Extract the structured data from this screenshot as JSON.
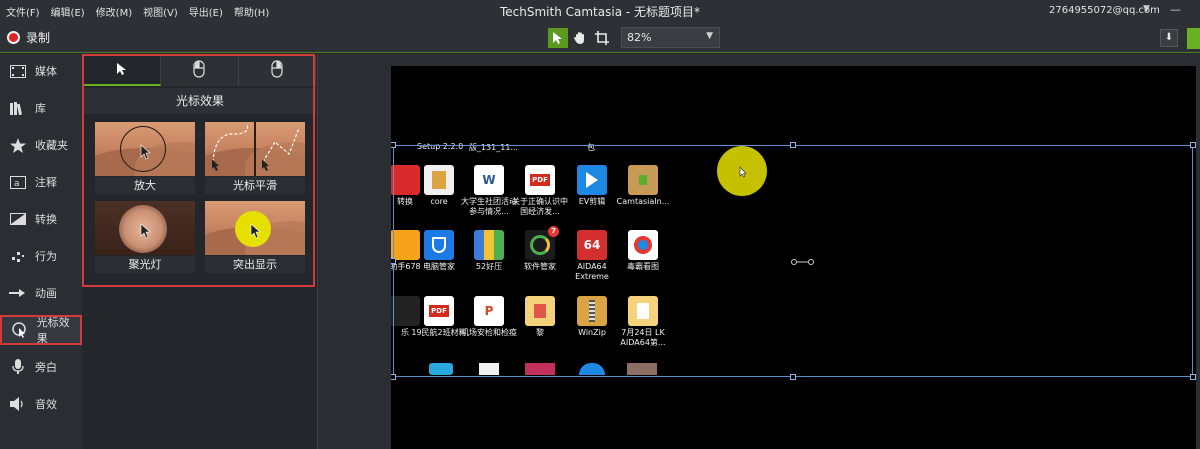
{
  "menubar": {
    "menus": [
      "文件(F)",
      "编辑(E)",
      "修改(M)",
      "视图(V)",
      "导出(E)",
      "帮助(H)"
    ],
    "title": "TechSmith Camtasia - 无标题项目*",
    "account": "2764955072@qq.com",
    "account_caret": "▼",
    "minimize": "—"
  },
  "toolbar": {
    "record_label": "录制",
    "zoom_value": "82%",
    "zoom_caret": "▼",
    "download_icon": "⬇"
  },
  "sidebar": {
    "items": [
      {
        "label": "媒体",
        "icon": "film-icon"
      },
      {
        "label": "库",
        "icon": "library-icon"
      },
      {
        "label": "收藏夹",
        "icon": "star-icon"
      },
      {
        "label": "注释",
        "icon": "annotation-icon"
      },
      {
        "label": "转换",
        "icon": "transition-icon"
      },
      {
        "label": "行为",
        "icon": "behavior-icon"
      },
      {
        "label": "动画",
        "icon": "animation-icon"
      },
      {
        "label": "光标效果",
        "icon": "cursor-effect-icon"
      },
      {
        "label": "旁白",
        "icon": "microphone-icon"
      },
      {
        "label": "音效",
        "icon": "speaker-icon"
      }
    ],
    "active_index": 7
  },
  "panel": {
    "tabs": [
      "pointer-icon",
      "left-click-icon",
      "right-click-icon"
    ],
    "title": "光标效果",
    "effects": [
      {
        "label": "放大"
      },
      {
        "label": "光标平滑"
      },
      {
        "label": "聚光灯"
      },
      {
        "label": "突出显示"
      }
    ]
  },
  "canvas": {
    "top_labels": [
      "Setup 2.2.0",
      "版_131_11...",
      "包"
    ],
    "icons": [
      {
        "label": "转换"
      },
      {
        "label": "core"
      },
      {
        "label": "大学生社团活动参与情况..."
      },
      {
        "label": "关于正确认识中国经济发..."
      },
      {
        "label": "EV剪辑"
      },
      {
        "label": "CamtasiaIn..."
      },
      {
        "label": "助手678"
      },
      {
        "label": "电脑管家"
      },
      {
        "label": "52好压"
      },
      {
        "label": "软件管家"
      },
      {
        "label": "AIDA64 Extreme"
      },
      {
        "label": "毒霸看图"
      },
      {
        "label": "乐"
      },
      {
        "label": "19民航2班材料"
      },
      {
        "label": "机场安检和检疫"
      },
      {
        "label": "黎"
      },
      {
        "label": "WinZip"
      },
      {
        "label": "7月24日 LK AIDA64第..."
      }
    ],
    "badges": {
      "software_manager": "7",
      "aida_number": "64"
    }
  },
  "colors": {
    "accent_green": "#6ab023",
    "highlight_red": "#d23b3b",
    "record_red": "#e02323",
    "spot_yellow": "#c6c100"
  }
}
